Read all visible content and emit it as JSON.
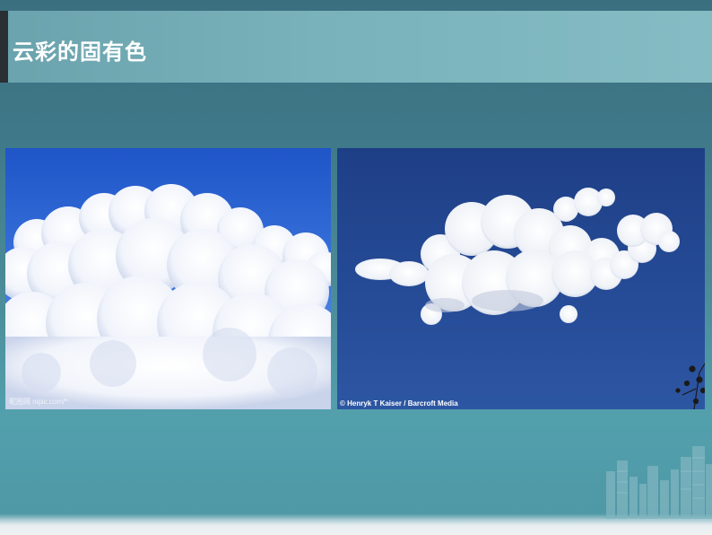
{
  "slide": {
    "title": "云彩的固有色"
  },
  "photos": {
    "left": {
      "subject": "cumulus clouds on blue sky",
      "watermark": "昵图网 nipic.com/*"
    },
    "right": {
      "subject": "whale-shaped cloud on dark blue sky",
      "credit": "© Henryk T Kaiser / Barcroft Media"
    }
  },
  "colors": {
    "title_band": "#79b2bb",
    "background_top": "#3a6f80",
    "background_bottom": "#53a0ad",
    "sky_left": "#2a5fcf",
    "sky_right": "#23468f"
  }
}
